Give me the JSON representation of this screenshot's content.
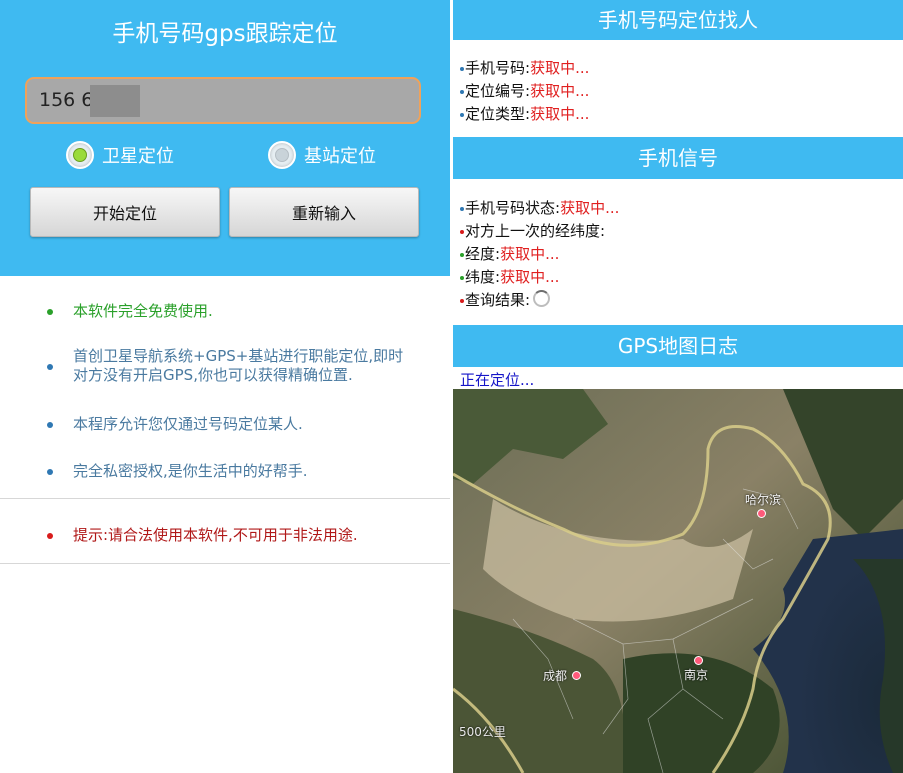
{
  "left": {
    "title": "手机号码gps跟踪定位",
    "phone_value": "156 6666",
    "radio_options": [
      {
        "label": "卫星定位",
        "selected": true
      },
      {
        "label": "基站定位",
        "selected": false
      }
    ],
    "buttons": {
      "start": "开始定位",
      "reenter": "重新输入"
    },
    "features": [
      {
        "text": "本软件完全免费使用.",
        "color": "#2aa02a",
        "bullet_color": "#2aa02a"
      },
      {
        "text_line1": "首创卫星导航系统+GPS+基站进行职能定位,即时",
        "text_line2": "对方没有开启GPS,你也可以获得精确位置.",
        "color": "#4a7aa0",
        "bullet_color": "#2f78b3"
      },
      {
        "text": "本程序允许您仅通过号码定位某人.",
        "color": "#4a7aa0",
        "bullet_color": "#2f78b3"
      },
      {
        "text": "完全私密授权,是你生活中的好帮手.",
        "color": "#4a7aa0",
        "bullet_color": "#2f78b3"
      }
    ],
    "tip": {
      "text": "提示:请合法使用本软件,不可用于非法用途.",
      "color": "#b01818",
      "bullet_color": "#d81b1b"
    }
  },
  "right": {
    "section1_title": "手机号码定位找人",
    "info": [
      {
        "label": "手机号码:",
        "value": "获取中..."
      },
      {
        "label": "定位编号:",
        "value": "获取中..."
      },
      {
        "label": "定位类型:",
        "value": "获取中..."
      }
    ],
    "section2_title": "手机信号",
    "signal": [
      {
        "label": "手机号码状态:",
        "value": "获取中...",
        "dot": "#2f78b3"
      },
      {
        "label": "对方上一次的经纬度:",
        "value": "",
        "dot": "#d81b1b"
      },
      {
        "label": "经度:",
        "value": "获取中...",
        "dot": "#2aa02a"
      },
      {
        "label": "纬度:",
        "value": "获取中...",
        "dot": "#2aa02a"
      },
      {
        "label": "查询结果:",
        "value": "",
        "dot": "#d81b1b"
      }
    ],
    "section3_title": "GPS地图日志",
    "locating_text": "正在定位...",
    "map": {
      "cities": [
        "哈尔滨",
        "成都",
        "南京"
      ],
      "scale_label": "500公里"
    }
  },
  "colors": {
    "accent": "#3fbaf1",
    "input_border": "#f0a25a",
    "value_red": "#e02020"
  }
}
